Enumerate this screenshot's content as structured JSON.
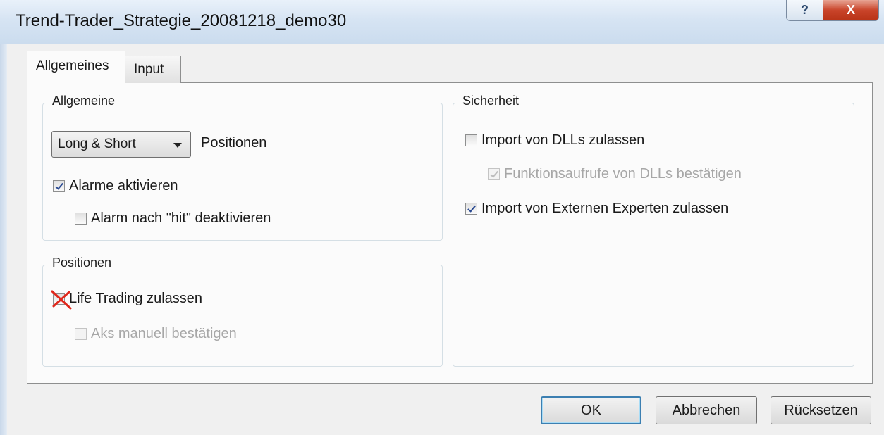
{
  "window": {
    "title": "Trend-Trader_Strategie_20081218_demo30",
    "help_label": "?",
    "close_label": "X"
  },
  "tabs": [
    {
      "label": "Allgemeines",
      "active": true
    },
    {
      "label": "Input",
      "active": false
    }
  ],
  "general_group": {
    "title": "Allgemeine",
    "positions_select": {
      "value": "Long & Short"
    },
    "positions_label": "Positionen",
    "enable_alerts": {
      "label": "Alarme aktivieren",
      "checked": true
    },
    "disable_after_hit": {
      "label": "Alarm nach \"hit\" deaktivieren",
      "checked": false
    }
  },
  "positions_group": {
    "title": "Positionen",
    "allow_live_trading": {
      "label": "Life Trading zulassen",
      "checked": false,
      "crossed_out": true,
      "cross_color": "#e0281c"
    },
    "confirm_manually": {
      "label": "Aks manuell bestätigen",
      "checked": false,
      "disabled": true
    }
  },
  "security_group": {
    "title": "Sicherheit",
    "allow_dll_import": {
      "label": "Import von DLLs zulassen",
      "checked": false
    },
    "confirm_dll_calls": {
      "label": "Funktionsaufrufe von DLLs bestätigen",
      "checked": true,
      "disabled": true
    },
    "allow_external_experts": {
      "label": "Import von Externen Experten zulassen",
      "checked": true
    }
  },
  "buttons": {
    "ok": "OK",
    "cancel": "Abbrechen",
    "reset": "Rücksetzen"
  }
}
